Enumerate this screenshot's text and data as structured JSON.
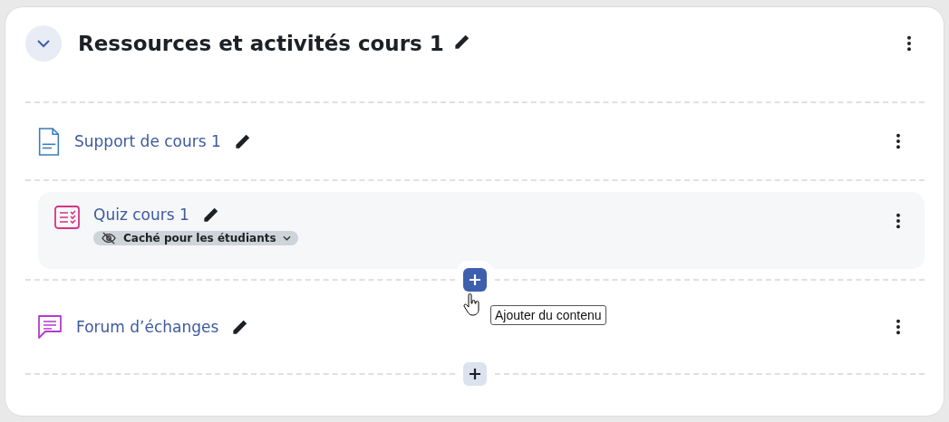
{
  "section": {
    "title": "Ressources et activités cours 1",
    "expanded": true
  },
  "activities": [
    {
      "kind": "pdf",
      "title": "Support de cours 1",
      "highlighted": false
    },
    {
      "kind": "quiz",
      "title": "Quiz cours 1",
      "highlighted": true,
      "badge": "Caché pour les étudiants",
      "add_button_after": {
        "active": true,
        "tooltip": "Ajouter du contenu"
      }
    },
    {
      "kind": "forum",
      "title": "Forum d’échanges",
      "highlighted": false,
      "add_button_after": {
        "active": false
      }
    }
  ]
}
